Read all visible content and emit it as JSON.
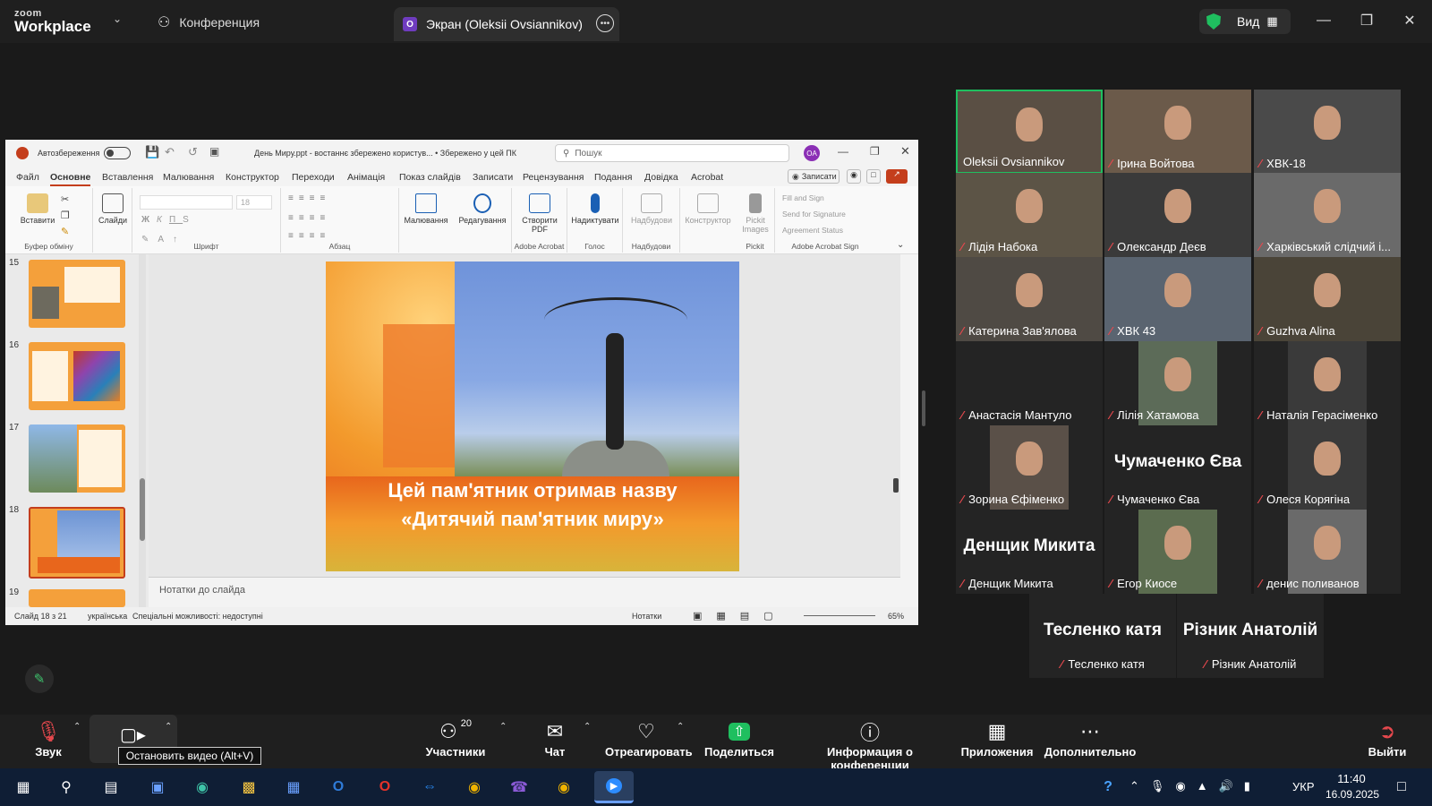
{
  "zoom": {
    "logo_top": "zoom",
    "logo_bottom": "Workplace",
    "tab_conference": "Конференция",
    "tab_screen": "Экран (Oleksii Ovsiannikov)",
    "tab_screen_badge": "O",
    "view_label": "Вид",
    "accent_green": "#1fbf5f",
    "mute_red": "#e5484d"
  },
  "ppt": {
    "autosave": "Автозбереження",
    "file_title": "День Миру.ppt - востаннє збережено користув... • Збережено у цей ПК",
    "search_placeholder": "Пошук",
    "user_initials": "OA",
    "menu": [
      "Файл",
      "Основне",
      "Вставлення",
      "Малювання",
      "Конструктор",
      "Переходи",
      "Анімація",
      "Показ слайдів",
      "Записати",
      "Рецензування",
      "Подання",
      "Довідка",
      "Acrobat"
    ],
    "record_btn": "Записати",
    "ribbon": {
      "paste": "Вставити",
      "slides": "Слайди",
      "clipboard": "Буфер обміну",
      "font": "Шрифт",
      "font_size": "18",
      "paragraph": "Абзац",
      "drawing": "Малювання",
      "editing": "Редагування",
      "create_pdf": "Створити PDF",
      "adobe_acrobat": "Adobe Acrobat",
      "dictate": "Надиктувати",
      "voice": "Голос",
      "addins_btn": "Надбудови",
      "addins_group": "Надбудови",
      "designer": "Конструктор",
      "pickit_btn": "Pickit Images",
      "pickit_group": "Pickit",
      "fill_sign": "Fill and Sign",
      "send_sig": "Send for Signature",
      "agreement": "Agreement Status",
      "acrobat_sign": "Adobe Acrobat Sign"
    },
    "thumb_numbers": [
      "15",
      "16",
      "17",
      "18",
      "19"
    ],
    "slide_text_line1": "Цей пам'ятник отримав назву",
    "slide_text_line2": "«Дитячий пам'ятник миру»",
    "notes_placeholder": "Нотатки до слайда",
    "status": {
      "slide": "Слайд 18 з 21",
      "lang": "українська",
      "accessibility": "Спеціальні можливості: недоступні",
      "notes": "Нотатки",
      "zoom": "65%"
    }
  },
  "participants": [
    {
      "name": "Oleksii Ovsiannikov",
      "muted": false,
      "big": ""
    },
    {
      "name": "Ірина Войтова",
      "muted": true,
      "big": ""
    },
    {
      "name": "ХВК-18",
      "muted": true,
      "big": ""
    },
    {
      "name": "Лідія Набока",
      "muted": true,
      "big": ""
    },
    {
      "name": "Олександр Деєв",
      "muted": true,
      "big": ""
    },
    {
      "name": "Харківський слідчий і...",
      "muted": true,
      "big": ""
    },
    {
      "name": "Катерина Зав'ялова",
      "muted": true,
      "big": ""
    },
    {
      "name": "ХВК 43",
      "muted": true,
      "big": ""
    },
    {
      "name": "Guzhva Alina",
      "muted": true,
      "big": ""
    },
    {
      "name": "Анастасія Мантуло",
      "muted": true,
      "big": ""
    },
    {
      "name": "Лілія Хатамова",
      "muted": true,
      "big": ""
    },
    {
      "name": "Наталія Герасіменко",
      "muted": true,
      "big": ""
    },
    {
      "name": "Зорина Єфіменко",
      "muted": true,
      "big": ""
    },
    {
      "name": "Чумаченко Єва",
      "muted": true,
      "big": "Чумаченко Єва"
    },
    {
      "name": "Олеся Корягіна",
      "muted": true,
      "big": ""
    },
    {
      "name": "Денщик Микита",
      "muted": true,
      "big": "Денщик Микита"
    },
    {
      "name": "Егор Киосе",
      "muted": true,
      "big": ""
    },
    {
      "name": "денис поливанов",
      "muted": true,
      "big": ""
    },
    {
      "name": "Тесленко катя",
      "muted": true,
      "big": "Тесленко катя"
    },
    {
      "name": "Різник Анатолій",
      "muted": true,
      "big": "Різник Анатолій"
    }
  ],
  "toolbar": {
    "audio": "Звук",
    "participants": "Участники",
    "participants_count": "20",
    "chat": "Чат",
    "react": "Отреагировать",
    "share": "Поделиться",
    "info": "Информация о конференции",
    "apps": "Приложения",
    "more": "Дополнительно",
    "leave": "Выйти",
    "video_tooltip": "Остановить видео (Alt+V)"
  },
  "taskbar": {
    "lang": "УКР",
    "time": "11:40",
    "date": "16.09.2025"
  }
}
